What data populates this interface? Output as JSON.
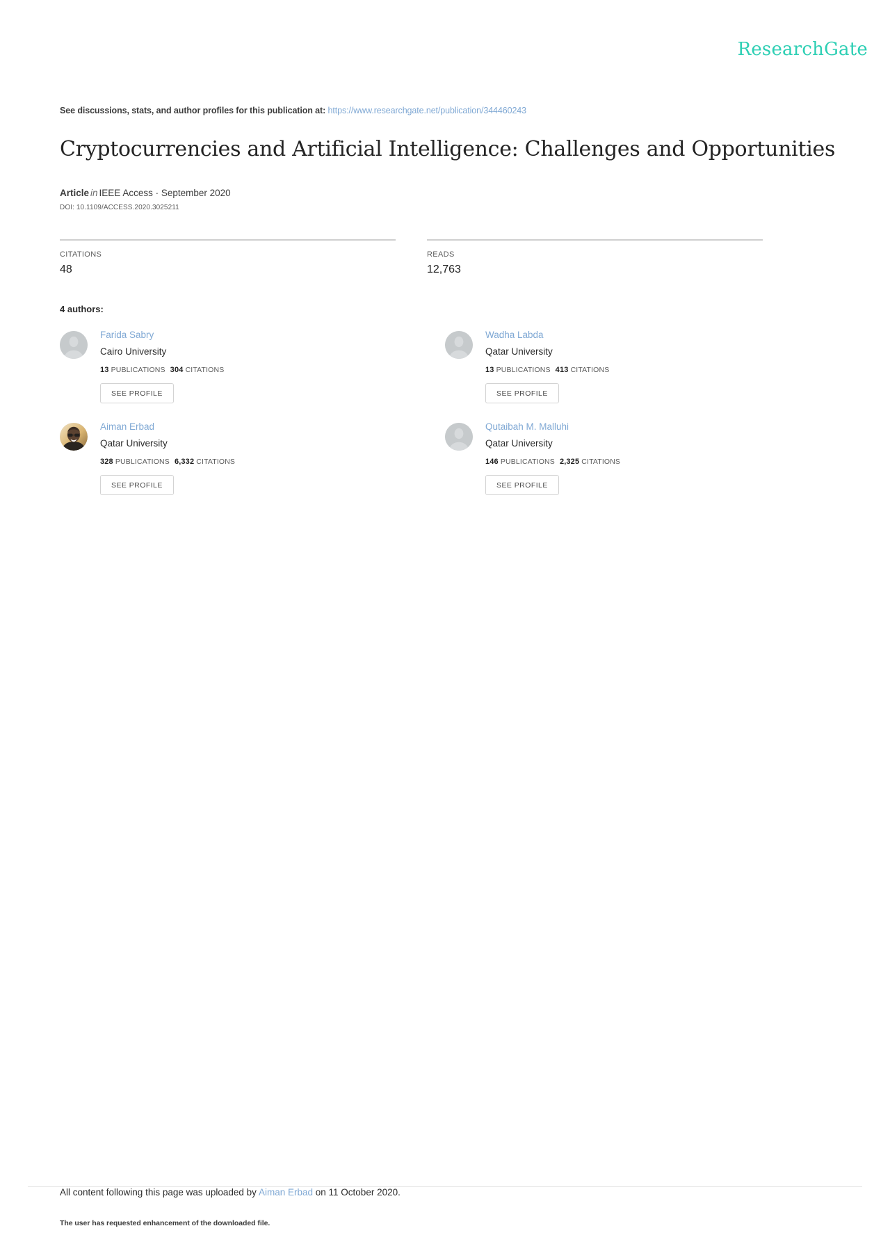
{
  "brand": {
    "name": "ResearchGate",
    "accent_color": "#2ecfb4",
    "link_color": "#7fa8d4"
  },
  "header": {
    "discussions_prefix": "See discussions, stats, and author profiles for this publication at:",
    "publication_url": "https://www.researchgate.net/publication/344460243"
  },
  "publication": {
    "title": "Cryptocurrencies and Artificial Intelligence: Challenges and Opportunities",
    "type": "Article",
    "in_word": "in",
    "venue": "IEEE Access · September 2020",
    "doi": "DOI: 10.1109/ACCESS.2020.3025211"
  },
  "stats": [
    {
      "label": "CITATIONS",
      "value": "48"
    },
    {
      "label": "READS",
      "value": "12,763"
    }
  ],
  "authors_section": {
    "heading": "4 authors:",
    "publications_label": "PUBLICATIONS",
    "citations_label": "CITATIONS",
    "see_profile_label": "SEE PROFILE"
  },
  "authors": [
    {
      "name": "Farida Sabry",
      "affiliation": "Cairo University",
      "publications": "13",
      "citations": "304",
      "avatar": "placeholder-avatar-icon"
    },
    {
      "name": "Wadha Labda",
      "affiliation": "Qatar University",
      "publications": "13",
      "citations": "413",
      "avatar": "placeholder-avatar-icon"
    },
    {
      "name": "Aiman Erbad",
      "affiliation": "Qatar University",
      "publications": "328",
      "citations": "6,332",
      "avatar": "photo-avatar"
    },
    {
      "name": "Qutaibah M. Malluhi",
      "affiliation": "Qatar University",
      "publications": "146",
      "citations": "2,325",
      "avatar": "placeholder-avatar-icon"
    }
  ],
  "footer": {
    "upload_prefix": "All content following this page was uploaded by",
    "uploader": "Aiman Erbad",
    "upload_suffix": "on 11 October 2020.",
    "note": "The user has requested enhancement of the downloaded file."
  }
}
